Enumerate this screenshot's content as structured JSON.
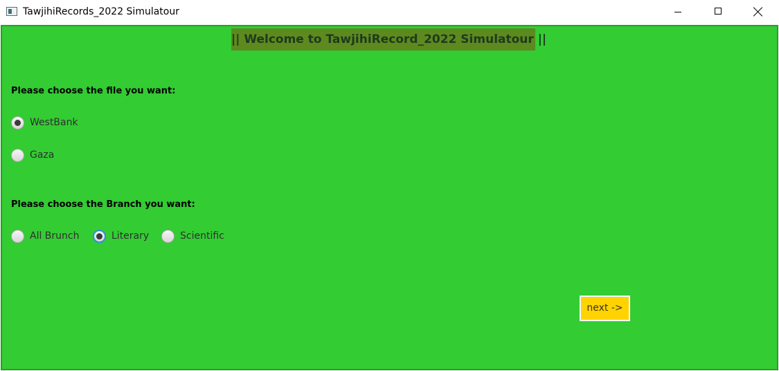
{
  "window": {
    "title": "TawjihiRecords_2022 Simulatour"
  },
  "banner": {
    "text": "|| Welcome to TawjihiRecord_2022 Simulatour ||"
  },
  "file_section": {
    "label": "Please choose the file you want:",
    "options": [
      {
        "label": "WestBank",
        "selected": true
      },
      {
        "label": "Gaza",
        "selected": false
      }
    ]
  },
  "branch_section": {
    "label": "Please choose the Branch you want:",
    "options": [
      {
        "label": "All Brunch",
        "selected": false
      },
      {
        "label": "Literary",
        "selected": true
      },
      {
        "label": "Scientific",
        "selected": false
      }
    ]
  },
  "next_button": {
    "label": "next ->"
  },
  "colors": {
    "background": "#33cc33",
    "banner": "#5c8a1f",
    "button": "#ffd300",
    "focus": "#2f8fe0"
  }
}
